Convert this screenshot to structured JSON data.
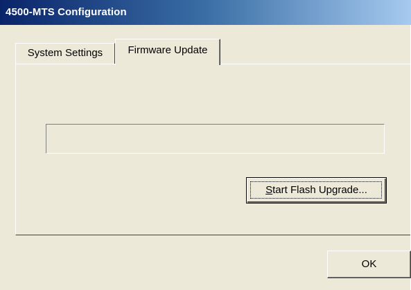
{
  "window": {
    "title": "4500-MTS Configuration"
  },
  "tabs": [
    {
      "label": "System Settings",
      "active": false
    },
    {
      "label": "Firmware Update",
      "active": true
    }
  ],
  "firmware_update": {
    "progress": 0,
    "flash_button": {
      "mnemonic": "S",
      "rest": "tart Flash Upgrade..."
    }
  },
  "footer": {
    "ok_label": "OK"
  },
  "colors": {
    "face": "#ece9d8",
    "title_start": "#0a246a",
    "title_end": "#a6caf0",
    "title_text": "#ffffff"
  }
}
